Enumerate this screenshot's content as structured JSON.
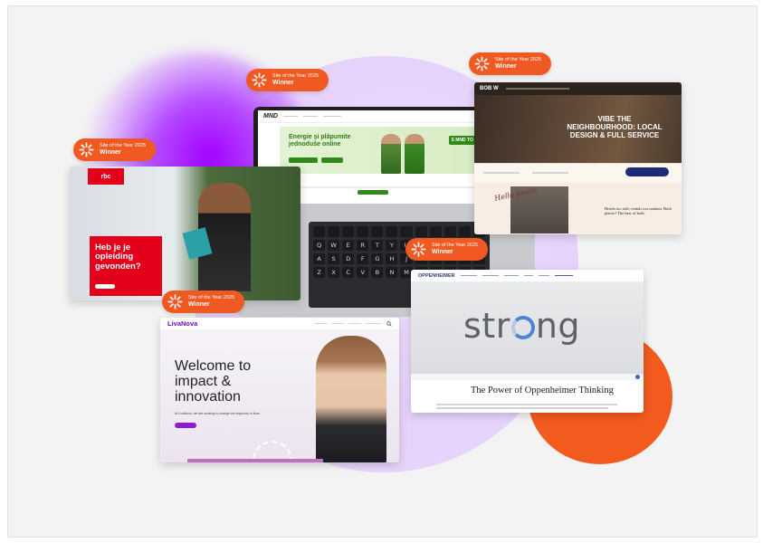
{
  "badge": {
    "line1": "Site of the Year 2025",
    "line2": "Winner"
  },
  "colors": {
    "accent": "#f05a22",
    "purple": "#a100ff",
    "background": "#f3f3f4"
  },
  "mnd": {
    "logo": "MND",
    "headline": "Energie și plăpumite jednoduše online",
    "tag": "S MND TO JDE"
  },
  "bob": {
    "logo": "BOB W",
    "headline": "VIBE THE NEIGHBOURHOOD: LOCAL DESIGN & FULL SERVICE",
    "script_text": "Hello locals",
    "footer_text": "Hotels too stiff, rentals too random. Both places? The best of both."
  },
  "rbc": {
    "logo": "rbc",
    "headline": "Heb je je opleiding gevonden?"
  },
  "livanova": {
    "logo": "LivaNova",
    "headline": "Welcome to impact & innovation",
    "subtext": "At LivaNova, we are working to change the trajectory of lives.",
    "button": "Learn more"
  },
  "oppenheimer": {
    "logo": "OPPENHEIMER",
    "hero_word_start": "str",
    "hero_word_end": "ng",
    "title": "The Power of Oppenheimer Thinking"
  },
  "keyboard": {
    "row1": [
      "",
      "",
      "",
      "",
      "",
      "",
      "",
      "",
      "",
      "",
      "",
      ""
    ],
    "row2": [
      "Q",
      "W",
      "E",
      "R",
      "T",
      "Y",
      "U",
      "I",
      "O",
      "P",
      "",
      ""
    ],
    "row3": [
      "A",
      "S",
      "D",
      "F",
      "G",
      "H",
      "J",
      "K",
      "L",
      "",
      "",
      ""
    ],
    "row4": [
      "Z",
      "X",
      "C",
      "V",
      "B",
      "N",
      "M",
      "",
      "",
      "",
      "",
      ""
    ]
  }
}
